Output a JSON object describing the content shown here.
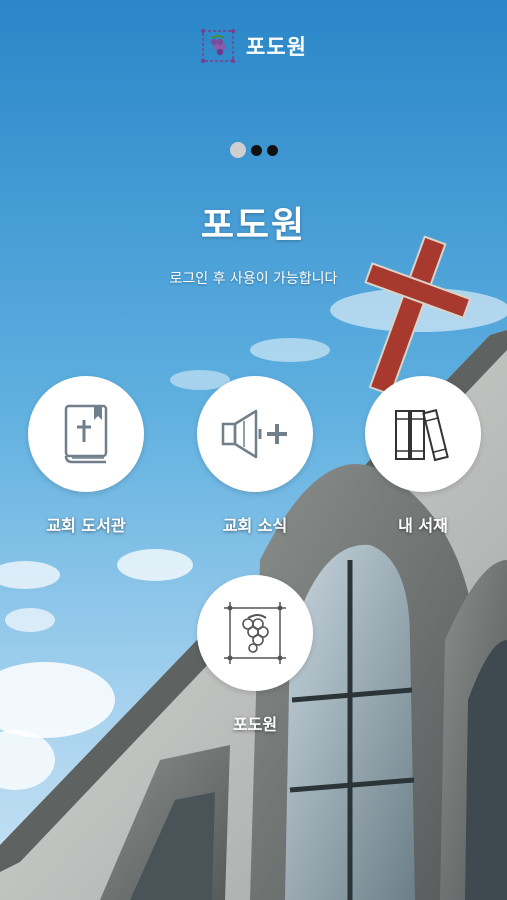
{
  "header": {
    "title": "포도원",
    "logo_icon": "grape-logo-icon"
  },
  "pager": {
    "total": 3,
    "active_index": 0
  },
  "hero": {
    "title": "포도원",
    "subtitle": "로그인 후 사용이 가능합니다"
  },
  "menu": [
    {
      "label": "교회 도서관",
      "icon": "bible-icon"
    },
    {
      "label": "교회 소식",
      "icon": "speaker-plus-icon"
    },
    {
      "label": "내 서재",
      "icon": "books-icon"
    },
    {
      "label": "포도원",
      "icon": "grape-frame-icon"
    }
  ],
  "colors": {
    "sky": "#2f8fd0",
    "accent_purple": "#7a3f8c",
    "icon_gray": "#6f7f8c",
    "label": "#ffffff"
  }
}
